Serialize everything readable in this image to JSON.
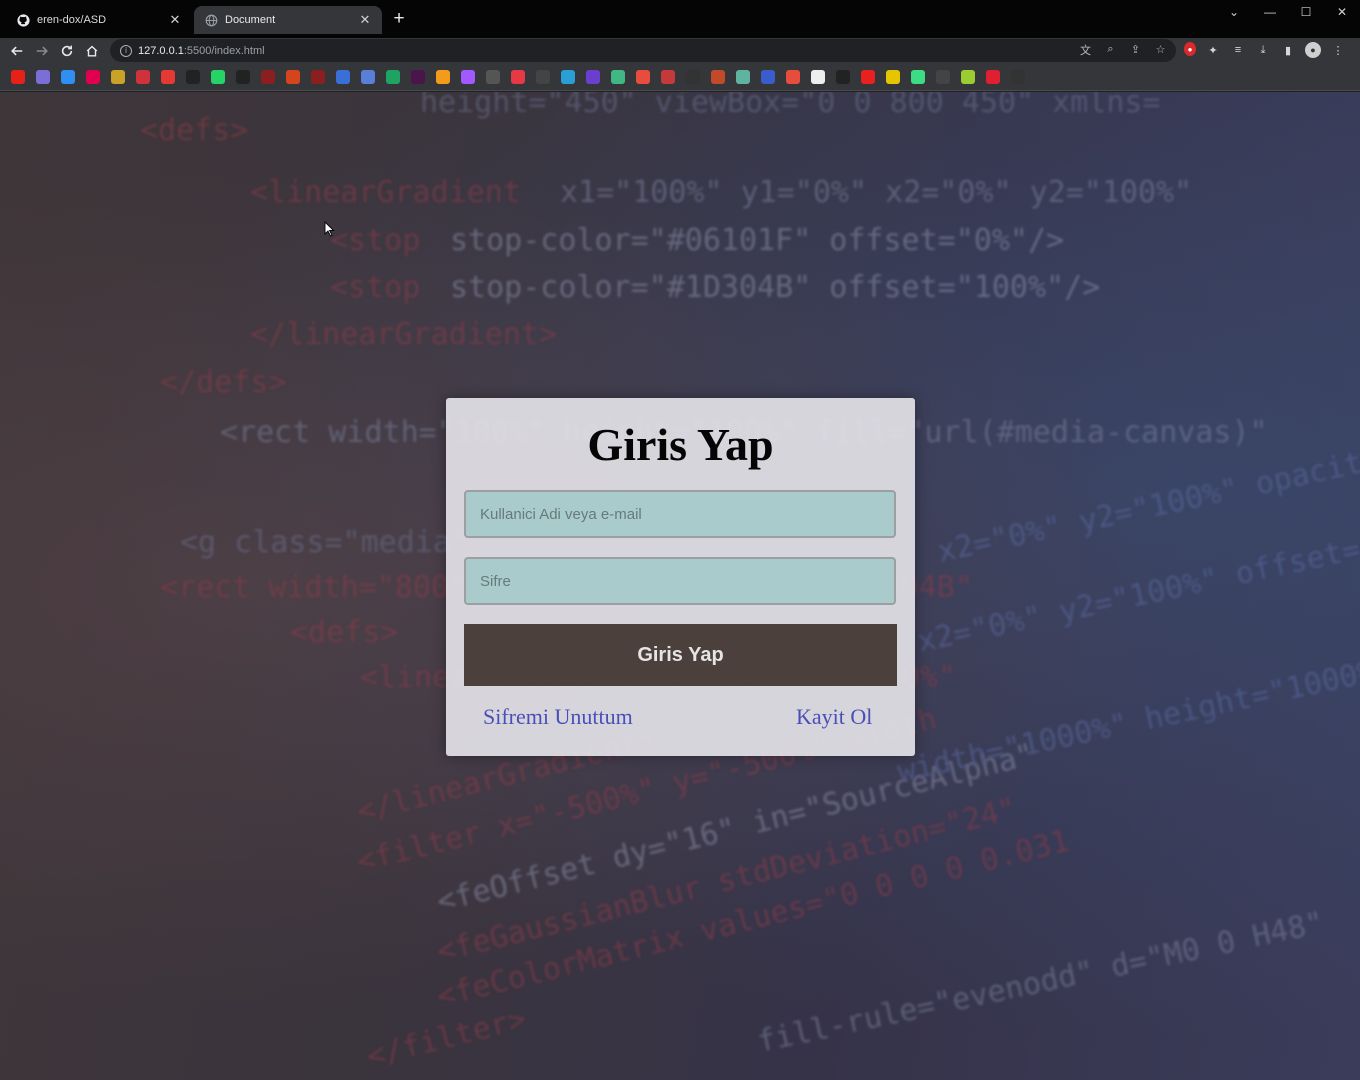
{
  "browser": {
    "tabs": [
      {
        "title": "eren-dox/ASD",
        "icon": "github-icon",
        "active": false
      },
      {
        "title": "Document",
        "icon": "globe-icon",
        "active": true
      }
    ],
    "new_tab": "+",
    "window_controls": {
      "minimize": "—",
      "maximize": "☐",
      "close": "✕",
      "tab_search": "⌄"
    },
    "address": {
      "host": "127.0.0.1",
      "path": ":5500/index.html"
    },
    "bookmark_icons": [
      "youtube-icon",
      "gmail-icon",
      "drive-icon",
      "yahoo-icon",
      "goodreads-icon",
      "bookmark-icon",
      "c-icon",
      "x-icon",
      "whatsapp-icon",
      "tiktok-icon",
      "pinterest-icon",
      "m-icon",
      "pinterest-icon",
      "dash-icon",
      "calendar-icon",
      "sheets-icon",
      "slack-icon",
      "box-icon",
      "figma-icon",
      "code-icon",
      "app-icon",
      "globe-icon",
      "b-icon",
      "b-icon",
      "vue-icon",
      "color-icon",
      "o-icon",
      "codepen-icon",
      "tool-icon",
      "square-icon",
      "flag-icon",
      "pin-icon",
      "doc-icon",
      "fp-icon",
      "red-dot-icon",
      "ixi-icon",
      "android-icon",
      "arrow-icon",
      "x2-icon",
      "red-circle-icon",
      "github-icon"
    ]
  },
  "login": {
    "title": "Giris Yap",
    "username_placeholder": "Kullanici Adi veya e-mail",
    "password_placeholder": "Sifre",
    "submit_label": "Giris Yap",
    "forgot_label": "Sifremi Unuttum",
    "register_label": "Kayit Ol"
  },
  "colors": {
    "card": "#e2e1e6",
    "input": "#a9cbcb",
    "button": "#4b403b",
    "link": "#4a4fb8"
  }
}
